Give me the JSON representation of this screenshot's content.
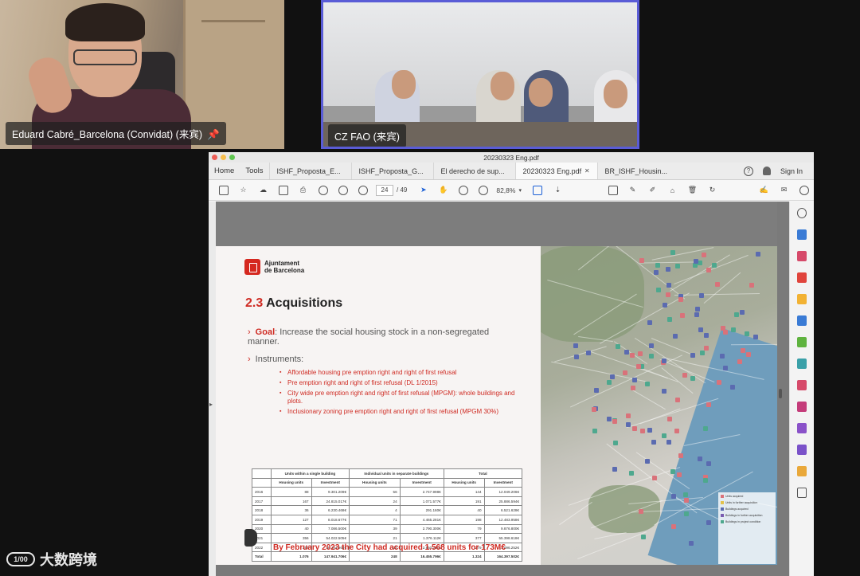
{
  "participants": [
    {
      "name": "Eduard Cabré_Barcelona (Convidat) (来宾)",
      "pinned": true
    },
    {
      "name": "CZ FAO (来宾)",
      "active_speaker": true
    }
  ],
  "window": {
    "title": "20230323 Eng.pdf",
    "nav": [
      "Home",
      "Tools"
    ],
    "tabs": [
      {
        "label": "ISHF_Proposta_E..."
      },
      {
        "label": "ISHF_Proposta_G..."
      },
      {
        "label": "El derecho de sup..."
      },
      {
        "label": "20230323 Eng.pdf",
        "active": true
      },
      {
        "label": "BR_ISHF_Housin..."
      }
    ],
    "sign_in": "Sign In",
    "help": "?"
  },
  "toolbar": {
    "page_current": "24",
    "page_total": "/ 49",
    "zoom": "82,8%"
  },
  "slide": {
    "logo_line1": "Ajuntament",
    "logo_line2": "de Barcelona",
    "section_num": "2.3",
    "section_title": "Acquisitions",
    "goal_keyword": "Goal",
    "goal_text": ": Increase the social housing stock in a non-segregated manner.",
    "instruments_label": "Instruments:",
    "bullets": [
      "Affordable housing pre emption right and right of first refusal",
      "Pre emption right and right of first refusal (DL 1/2015)",
      "City wide pre emption right and right of first refusal (MPGM): whole buildings and plots.",
      "Inclusionary zoning pre emption right and right of first refusal (MPGM 30%)"
    ],
    "table": {
      "group_headers": [
        "Units within a single building",
        "Individual units in separate buildings",
        "Total"
      ],
      "sub_headers": [
        "Housing units",
        "Investment",
        "Housing units",
        "Investment",
        "Housing units",
        "Investment"
      ],
      "rows": [
        [
          "2016",
          "88",
          "9.301.209€",
          "56",
          "2.747.998€",
          "144",
          "12.049.206€"
        ],
        [
          "2017",
          "167",
          "24.815.017€",
          "24",
          "1.071.577€",
          "191",
          "25.886.594€"
        ],
        [
          "2018",
          "36",
          "6.230.468€",
          "4",
          "291.160€",
          "40",
          "6.521.628€"
        ],
        [
          "2019",
          "127",
          "8.018.677€",
          "71",
          "4.465.281€",
          "198",
          "12.483.958€"
        ],
        [
          "2020",
          "40",
          "7.086.500€",
          "39",
          "2.790.300€",
          "79",
          "9.876.800€"
        ],
        [
          "2021",
          "356",
          "54.022.505€",
          "21",
          "1.376.112€",
          "377",
          "55.398.618€"
        ],
        [
          "2022",
          "257",
          "38.154.964€",
          "22",
          "2.950.241€",
          "279",
          "41.096.252€"
        ]
      ],
      "total": [
        "Total",
        "1.076",
        "147.941.706€",
        "248",
        "16.455.796€",
        "1.324",
        "164.397.502€"
      ]
    },
    "footnote": "By February 2023 the City had acquired 1.568 units for 173M€"
  },
  "map_legend": [
    "Units acquired",
    "Units in further acquisition",
    "Buildings acquired",
    "Buildings in further acquisition",
    "Buildings in project condition"
  ],
  "watermark": "大数跨境",
  "watermark_mark": "1/00",
  "colors": {
    "accent_red": "#cf2b23",
    "speaker_border": "#5a5cd6",
    "map_pin_blue": "#5b6bb0",
    "map_pin_green": "#4ea88e",
    "map_pin_red": "#d9727a"
  }
}
